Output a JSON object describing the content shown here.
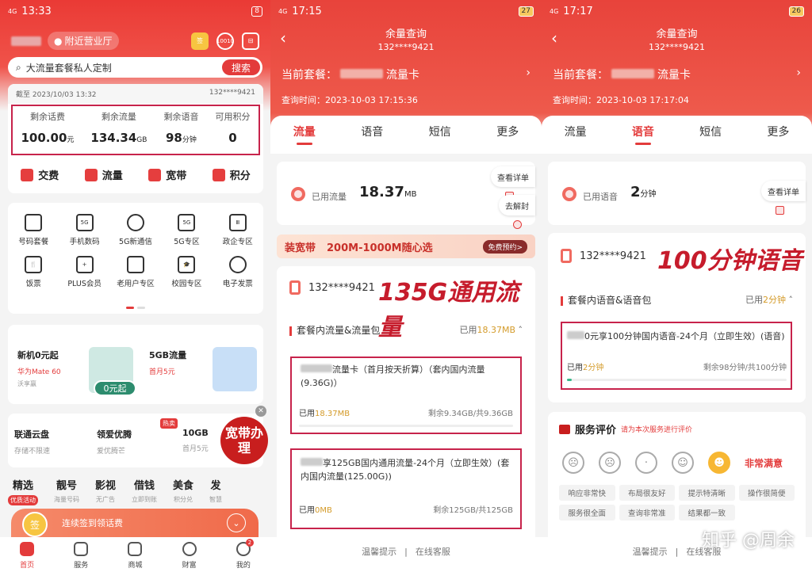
{
  "panel1": {
    "status": {
      "time": "13:33",
      "signal": "4G",
      "battery": "8"
    },
    "header": {
      "location": "附近营业厅",
      "icon1_label": "签",
      "icon2_label": "10010"
    },
    "search": {
      "placeholder": "大流量套餐私人定制",
      "button": "搜索"
    },
    "balance": {
      "snapshot": "截至 2023/10/03 13:32",
      "number": "132****9421",
      "stats": [
        {
          "label": "剩余话费",
          "value": "100.00",
          "unit": "元"
        },
        {
          "label": "剩余流量",
          "value": "134.34",
          "unit": "GB"
        },
        {
          "label": "剩余语音",
          "value": "98",
          "unit": "分钟"
        },
        {
          "label": "可用积分",
          "value": "0",
          "unit": ""
        }
      ],
      "quick": [
        "交费",
        "流量",
        "宽带",
        "积分"
      ]
    },
    "grid": [
      {
        "label": "号码套餐",
        "icon": "sim-icon"
      },
      {
        "label": "手机数码",
        "icon": "phone-5g-icon"
      },
      {
        "label": "5G新通信",
        "icon": "bulb-icon"
      },
      {
        "label": "5G专区",
        "icon": "5g-icon"
      },
      {
        "label": "政企专区",
        "icon": "building-icon"
      },
      {
        "label": "饭票",
        "icon": "cutlery-icon"
      },
      {
        "label": "PLUS会员",
        "icon": "plus-icon"
      },
      {
        "label": "老用户专区",
        "icon": "user-zone-icon"
      },
      {
        "label": "校园专区",
        "icon": "graduation-icon"
      },
      {
        "label": "电子发票",
        "icon": "invoice-icon"
      }
    ],
    "promo": {
      "left_title": "新机0元起",
      "left_sub": "华为Mate 60",
      "left_sub2": "沃享赢",
      "pill": "0元起",
      "right_title": "5GB流量",
      "right_sub": "首月5元"
    },
    "promo2": {
      "c1_title": "联通云盘",
      "c1_sub": "存储不限速",
      "c2_title": "领爱优腾",
      "c2_sub": "爱优腾芒",
      "c3_title": "10GB",
      "c3_sub": "首月5元",
      "hot": "热卖",
      "big": "宽带办理"
    },
    "tabs": [
      {
        "label": "精选",
        "sub": "优质活动"
      },
      {
        "label": "靓号",
        "sub": "海量号码"
      },
      {
        "label": "影视",
        "sub": "无广告"
      },
      {
        "label": "借钱",
        "sub": "立即到账"
      },
      {
        "label": "美食",
        "sub": "积分兑"
      },
      {
        "label": "发",
        "sub": "智慧"
      }
    ],
    "signin": {
      "text": "连续签到领话费",
      "coin": "签"
    },
    "bottom_nav": [
      {
        "label": "首页"
      },
      {
        "label": "服务"
      },
      {
        "label": "商城"
      },
      {
        "label": "财富"
      },
      {
        "label": "我的"
      }
    ],
    "badge": "2"
  },
  "panel2": {
    "status": {
      "time": "17:15",
      "signal": "4G",
      "battery": "27"
    },
    "title": "余量查询",
    "number": "132****9421",
    "plan_label": "当前套餐：",
    "plan_name": "流量卡",
    "query_time": "查询时间：2023-10-03 17:15:36",
    "tabs": [
      "流量",
      "语音",
      "短信",
      "更多"
    ],
    "used_label": "已用流量",
    "used_value": "18.37",
    "used_unit": "MB",
    "btn_detail": "查看详单",
    "btn_unseal": "去解封",
    "banner_a": "装宽带",
    "banner_b": "200M-1000M随心选",
    "banner_cta": "免费预约>",
    "card_number": "132****9421",
    "annotation": "135G通用流量",
    "section": "套餐内流量&流量包",
    "section_used_label": "已用",
    "section_used_value": "18.37MB",
    "pkg1_text": "流量卡（首月按天折算）（套内国内流量(9.36G)）",
    "pkg1_used_label": "已用",
    "pkg1_used_value": "18.37MB",
    "pkg1_remain": "剩余9.34GB/共9.36GB",
    "pkg2_text": "享125GB国内通用流量-24个月（立即生效）(套内国内流量(125.00G))",
    "pkg2_used_label": "已用",
    "pkg2_used_value": "0MB",
    "pkg2_remain": "剩余125GB/共125GB",
    "footer": [
      "温馨提示",
      "在线客服"
    ]
  },
  "panel3": {
    "status": {
      "time": "17:17",
      "signal": "4G",
      "battery": "26"
    },
    "title": "余量查询",
    "number": "132****9421",
    "plan_label": "当前套餐：",
    "plan_name": "流量卡",
    "query_time": "查询时间：2023-10-03 17:17:04",
    "tabs": [
      "流量",
      "语音",
      "短信",
      "更多"
    ],
    "used_label": "已用语音",
    "used_value": "2",
    "used_unit": "分钟",
    "btn_detail": "查看详单",
    "card_number": "132****9421",
    "annotation": "100分钟语音",
    "section": "套餐内语音&语音包",
    "section_used_label": "已用",
    "section_used_value": "2分钟",
    "pkg_text": "0元享100分钟国内语音-24个月（立即生效）(语音)",
    "pkg_used_label": "已用",
    "pkg_used_value": "2分钟",
    "pkg_remain": "剩余98分钟/共100分钟",
    "pkg_used_fraction": 0.02,
    "rating_title": "服务评价",
    "rating_sub": "请为本次服务进行评价",
    "rating_best": "非常满意",
    "tags": [
      "响应非常快",
      "布局很友好",
      "提示特清晰",
      "操作很简便",
      "服务很全面",
      "查询非常准",
      "结果都一致"
    ],
    "footer": [
      "温馨提示",
      "在线客服"
    ],
    "watermark": "知乎 @周余"
  }
}
